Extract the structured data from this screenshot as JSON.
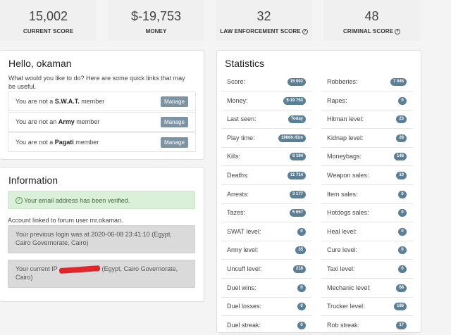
{
  "top_stats": [
    {
      "value": "15,002",
      "label": "CURRENT SCORE",
      "help": false
    },
    {
      "value": "$-19,753",
      "label": "MONEY",
      "help": false
    },
    {
      "value": "32",
      "label": "LAW ENFORCEMENT SCORE",
      "help": true
    },
    {
      "value": "48",
      "label": "CRIMINAL SCORE",
      "help": true
    }
  ],
  "hello": {
    "title": "Hello, okaman",
    "intro": "What would you like to do? Here are some quick links that may be useful.",
    "rows": [
      {
        "prefix": "You are not a ",
        "org": "S.W.A.T.",
        "suffix": " member",
        "button": "Manage"
      },
      {
        "prefix": "You are not an ",
        "org": "Army",
        "suffix": " member",
        "button": "Manage"
      },
      {
        "prefix": "You are not a ",
        "org": "Pagati",
        "suffix": " member",
        "button": "Manage"
      }
    ]
  },
  "information": {
    "title": "Information",
    "verified": "Your email address has been verified.",
    "forum": "Account linked to forum user mr.okaman.",
    "login": "Your previous login was at 2020-06-08 23:41:10 (Egypt, Cairo Governorate, Cairo)",
    "ip_prefix": "Your current IP ",
    "ip_suffix": " (Egypt, Cairo Governorate, Cairo)"
  },
  "statistics": {
    "title": "Statistics",
    "left": [
      {
        "label": "Score:",
        "value": "15 002"
      },
      {
        "label": "Money:",
        "value": "$-19 753"
      },
      {
        "label": "Last seen:",
        "value": "Today"
      },
      {
        "label": "Play time:",
        "value": "1986h:41m"
      },
      {
        "label": "Kills:",
        "value": "8 194"
      },
      {
        "label": "Deaths:",
        "value": "11 714"
      },
      {
        "label": "Arrests:",
        "value": "3 177"
      },
      {
        "label": "Tazes:",
        "value": "5 657"
      },
      {
        "label": "SWAT level:",
        "value": "0"
      },
      {
        "label": "Army level:",
        "value": "35"
      },
      {
        "label": "Uncuff level:",
        "value": "218"
      },
      {
        "label": "Duel wins:",
        "value": "0"
      },
      {
        "label": "Duel losses:",
        "value": "0"
      },
      {
        "label": "Duel streak:",
        "value": "0"
      }
    ],
    "right": [
      {
        "label": "Robberies:",
        "value": "7 045"
      },
      {
        "label": "Rapes:",
        "value": "0"
      },
      {
        "label": "Hitman level:",
        "value": "23"
      },
      {
        "label": "Kidnap level:",
        "value": "28"
      },
      {
        "label": "Moneybags:",
        "value": "148"
      },
      {
        "label": "Weapon sales:",
        "value": "10"
      },
      {
        "label": "Item sales:",
        "value": "0"
      },
      {
        "label": "Hotdogs sales:",
        "value": "0"
      },
      {
        "label": "Heal level:",
        "value": "0"
      },
      {
        "label": "Cure level:",
        "value": "0"
      },
      {
        "label": "Taxi level:",
        "value": "0"
      },
      {
        "label": "Mechanic level:",
        "value": "68"
      },
      {
        "label": "Trucker level:",
        "value": "186"
      },
      {
        "label": "Rob streak:",
        "value": "17"
      }
    ]
  },
  "colors": {
    "badge": "#5a7f97",
    "button": "#7c93a3",
    "verified_bg": "#dbf0d8",
    "redaction": "#e0262b"
  }
}
